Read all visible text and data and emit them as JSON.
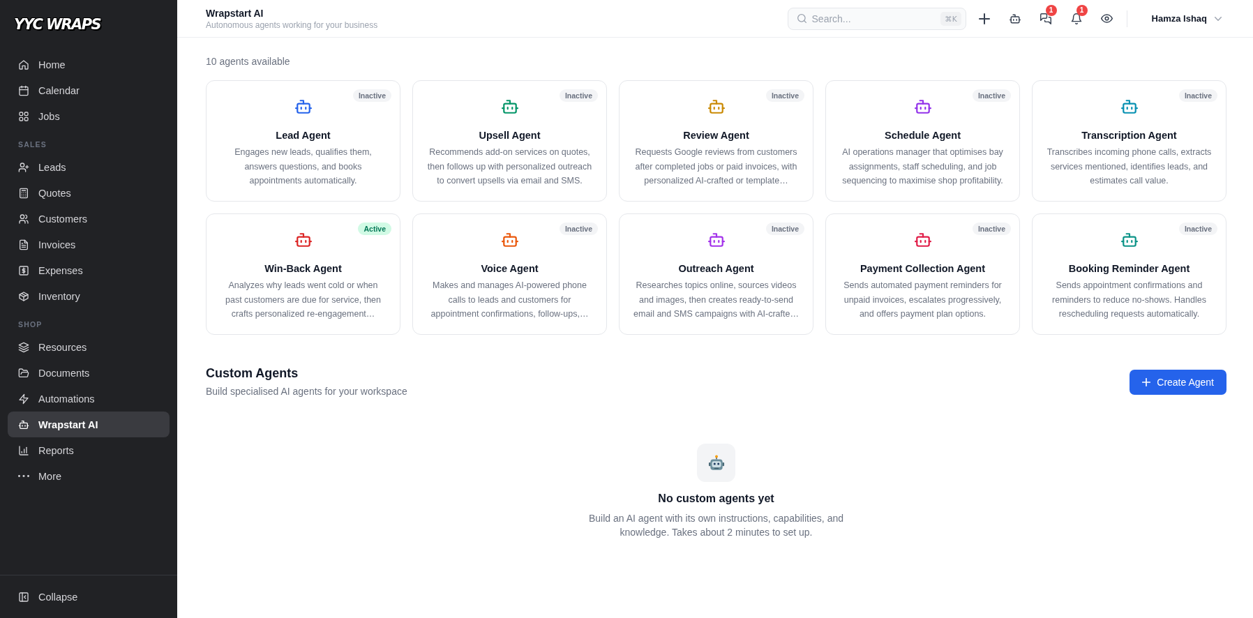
{
  "sidebar": {
    "logo": "YYC WRAPS",
    "sections": [
      {
        "items": [
          {
            "label": "Home",
            "selected": false
          },
          {
            "label": "Calendar",
            "selected": false
          },
          {
            "label": "Jobs",
            "selected": false
          }
        ]
      },
      {
        "heading": "SALES",
        "items": [
          {
            "label": "Leads",
            "selected": false
          },
          {
            "label": "Quotes",
            "selected": false
          },
          {
            "label": "Customers",
            "selected": false
          },
          {
            "label": "Invoices",
            "selected": false
          },
          {
            "label": "Expenses",
            "selected": false
          },
          {
            "label": "Inventory",
            "selected": false
          }
        ]
      },
      {
        "heading": "SHOP",
        "items": [
          {
            "label": "Resources",
            "selected": false
          },
          {
            "label": "Documents",
            "selected": false
          },
          {
            "label": "Automations",
            "selected": false
          },
          {
            "label": "Wrapstart AI",
            "selected": true
          },
          {
            "label": "Reports",
            "selected": false
          },
          {
            "label": "More",
            "selected": false
          }
        ]
      }
    ],
    "collapse": "Collapse"
  },
  "header": {
    "title": "Wrapstart AI",
    "subtitle": "Autonomous agents working for your business",
    "search": {
      "placeholder": "Search...",
      "shortcut": "⌘K"
    },
    "messages_badge": "1",
    "notifications_badge": "1",
    "user": "Hamza Ishaq"
  },
  "agents": {
    "count": "10 agents available",
    "items": [
      {
        "name": "Lead Agent",
        "description": "Engages new leads, qualifies them,\nanswers questions, and books\nappointments automatically.",
        "status": "Inactive",
        "active": false,
        "color": "#2563eb"
      },
      {
        "name": "Upsell Agent",
        "description": "Recommends add-on services on quotes,\nthen follows up with personalized outreach\nto convert upsells via email and SMS.",
        "status": "Inactive",
        "active": false,
        "color": "#059669"
      },
      {
        "name": "Review Agent",
        "description": "Requests Google reviews from customers\nafter completed jobs or paid invoices, with\npersonalized AI-crafted or template…",
        "status": "Inactive",
        "active": false,
        "color": "#ca8a04"
      },
      {
        "name": "Schedule Agent",
        "description": "AI operations manager that optimises bay\nassignments, staff scheduling, and job\nsequencing to maximise shop profitability.",
        "status": "Inactive",
        "active": false,
        "color": "#9333ea"
      },
      {
        "name": "Transcription Agent",
        "description": "Transcribes incoming phone calls, extracts\nservices mentioned, identifies leads, and\nestimates call value.",
        "status": "Inactive",
        "active": false,
        "color": "#0891b2"
      },
      {
        "name": "Win-Back Agent",
        "description": "Analyzes why leads went cold or when\npast customers are due for service, then\ncrafts personalized re-engagement…",
        "status": "Active",
        "active": true,
        "color": "#dc2626"
      },
      {
        "name": "Voice Agent",
        "description": "Makes and manages AI-powered phone\ncalls to leads and customers for\nappointment confirmations, follow-ups,…",
        "status": "Inactive",
        "active": false,
        "color": "#ea580c"
      },
      {
        "name": "Outreach Agent",
        "description": "Researches topics online, sources videos\nand images, then creates ready-to-send\nemail and SMS campaigns with AI-crafte…",
        "status": "Inactive",
        "active": false,
        "color": "#a333ea"
      },
      {
        "name": "Payment Collection Agent",
        "description": "Sends automated payment reminders for\nunpaid invoices, escalates progressively,\nand offers payment plan options.",
        "status": "Inactive",
        "active": false,
        "color": "#e11d48"
      },
      {
        "name": "Booking Reminder Agent",
        "description": "Sends appointment confirmations and\nreminders to reduce no-shows. Handles\nrescheduling requests automatically.",
        "status": "Inactive",
        "active": false,
        "color": "#0d9488"
      }
    ]
  },
  "custom_agents": {
    "title": "Custom Agents",
    "subtitle": "Build specialised AI agents for your workspace",
    "create_button": "Create Agent",
    "empty": {
      "title": "No custom agents yet",
      "text": "Build an AI agent with its own instructions, capabilities, and\nknowledge. Takes about 2 minutes to set up."
    }
  }
}
